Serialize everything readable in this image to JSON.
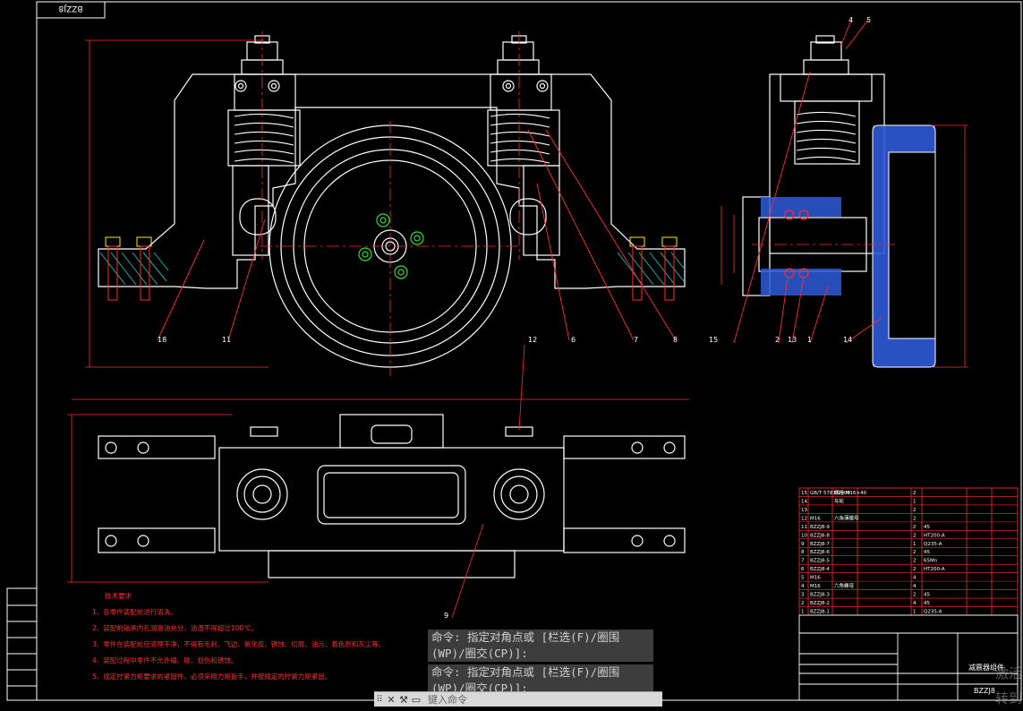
{
  "drawing": {
    "frame_tag": "BZZJ8",
    "bottom_title_code": "BZZJ8",
    "assembly_name": "减震器组件"
  },
  "part_labels": [
    "18",
    "11",
    "6",
    "7",
    "8",
    "4",
    "5",
    "15",
    "2",
    "13",
    "1",
    "14",
    "12",
    "9"
  ],
  "technical_requirements": {
    "title": "技术要求",
    "items": [
      "1、各零件装配前进行清洗。",
      "2、装配前轴承内孔润滑油充分，油温不得超过100℃。",
      "3、零件在装配前应清理干净，不得有毛刺、飞边、氧化皮、锈蚀、切屑、油污、着色剂和灰尘等。",
      "4、装配过程中零件不允许磕、碰、划伤和锈蚀。",
      "5、规定拧紧力矩要求的紧固件，必须采用力矩扳手，并按规定的拧紧力矩紧固。"
    ]
  },
  "bom_rows": [
    [
      "15",
      "GB/T 5781-2000",
      "螺栓 M16×40",
      "2",
      ""
    ],
    [
      "14",
      "",
      "车轮",
      "1",
      ""
    ],
    [
      "13",
      "",
      "",
      "2",
      ""
    ],
    [
      "12",
      "M16",
      "六角薄螺母",
      "2",
      ""
    ],
    [
      "11",
      "BZZJ8-9",
      "",
      "2",
      "45"
    ],
    [
      "10",
      "BZZJ8-8",
      "",
      "2",
      "HT200-A"
    ],
    [
      "9",
      "BZZJ8-7",
      "",
      "1",
      "Q235-A"
    ],
    [
      "8",
      "BZZJ8-6",
      "",
      "2",
      "45"
    ],
    [
      "7",
      "BZZJ8-5",
      "",
      "2",
      "65Mn"
    ],
    [
      "6",
      "BZZJ8-4",
      "",
      "2",
      "HT200-A"
    ],
    [
      "5",
      "M16",
      "",
      "4",
      ""
    ],
    [
      "4",
      "M16",
      "六角螺母",
      "4",
      ""
    ],
    [
      "3",
      "BZZJ8-3",
      "",
      "2",
      "45"
    ],
    [
      "2",
      "BZZJ8-2",
      "",
      "4",
      "45"
    ],
    [
      "1",
      "BZZJ8-1",
      "",
      "1",
      "Q235-A"
    ]
  ],
  "command_line": {
    "history": [
      "命令: 指定对角点或 [栏选(F)/圈围(WP)/圈交(CP)]:",
      "命令: 指定对角点或 [栏选(F)/圈围(WP)/圈交(CP)]:"
    ],
    "input_placeholder": "键入命令"
  },
  "watermark": "激活 转到",
  "colors": {
    "background": "#000000",
    "outline": "#ffffff",
    "center_line": "#ff2d2d",
    "leader": "#ff2d2d",
    "hatch": "#3a6df0",
    "green_circle": "#33dd33",
    "yellow": "#ffee00",
    "table_lines": "#ff2d2d"
  }
}
